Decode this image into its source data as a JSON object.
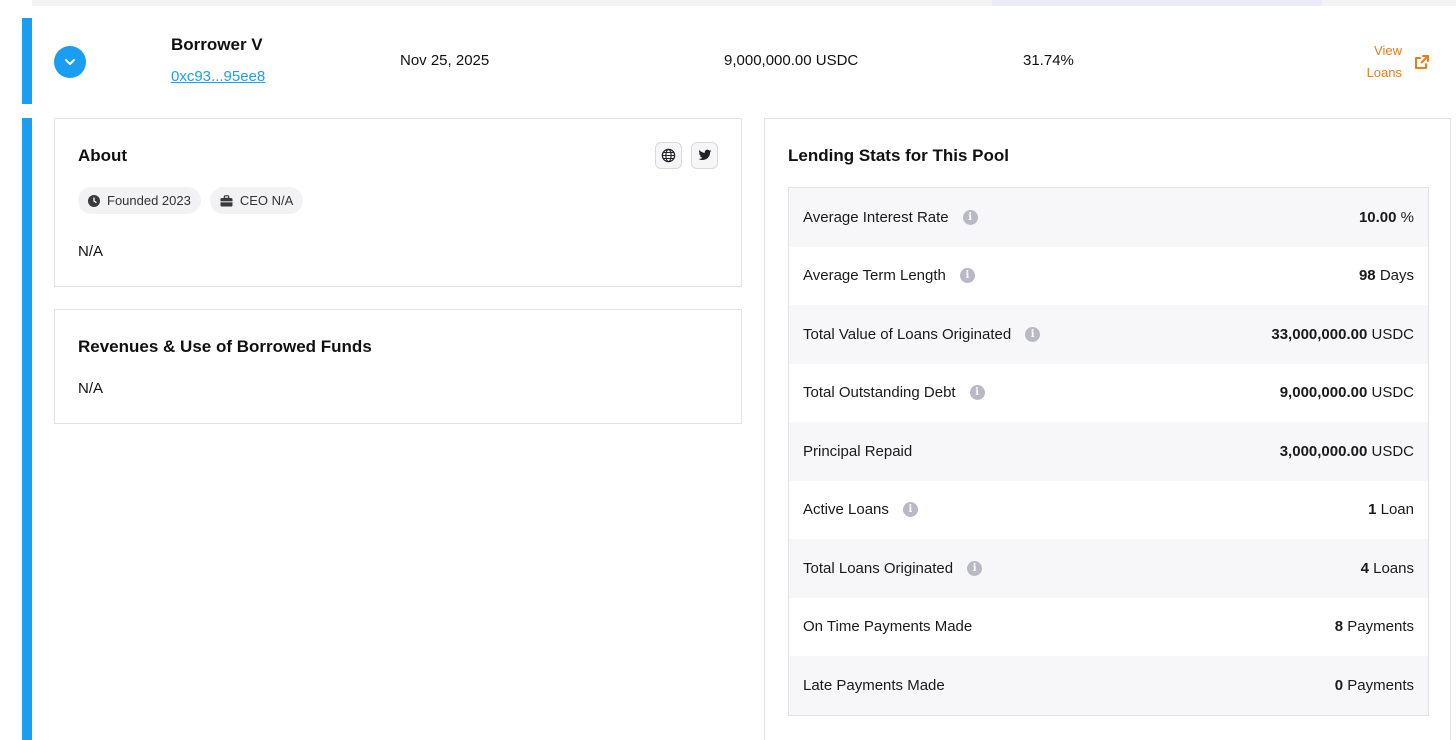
{
  "borrower": {
    "name": "Borrower V",
    "address": "0xc93...95ee8",
    "date": "Nov 25, 2025",
    "amount": "9,000,000.00 USDC",
    "rate": "31.74%",
    "view_loans_label": "View Loans"
  },
  "about": {
    "title": "About",
    "chips": [
      {
        "icon": "clock-icon",
        "label": "Founded 2023"
      },
      {
        "icon": "briefcase-icon",
        "label": "CEO N/A"
      }
    ],
    "body": "N/A"
  },
  "revenues": {
    "title": "Revenues & Use of Borrowed Funds",
    "body": "N/A"
  },
  "stats": {
    "title": "Lending Stats for This Pool",
    "rows": [
      {
        "label": "Average Interest Rate",
        "info": true,
        "value": "10.00",
        "unit": "%"
      },
      {
        "label": "Average Term Length",
        "info": true,
        "value": "98",
        "unit": "Days"
      },
      {
        "label": "Total Value of Loans Originated",
        "info": true,
        "value": "33,000,000.00",
        "unit": "USDC"
      },
      {
        "label": "Total Outstanding Debt",
        "info": true,
        "value": "9,000,000.00",
        "unit": "USDC"
      },
      {
        "label": "Principal Repaid",
        "info": false,
        "value": "3,000,000.00",
        "unit": "USDC"
      },
      {
        "label": "Active Loans",
        "info": true,
        "value": "1",
        "unit": "Loan"
      },
      {
        "label": "Total Loans Originated",
        "info": true,
        "value": "4",
        "unit": "Loans"
      },
      {
        "label": "On Time Payments Made",
        "info": false,
        "value": "8",
        "unit": "Payments"
      },
      {
        "label": "Late Payments Made",
        "info": false,
        "value": "0",
        "unit": "Payments"
      }
    ]
  },
  "colors": {
    "accent_blue": "#1a9ef2",
    "accent_orange": "#f07a1a"
  }
}
